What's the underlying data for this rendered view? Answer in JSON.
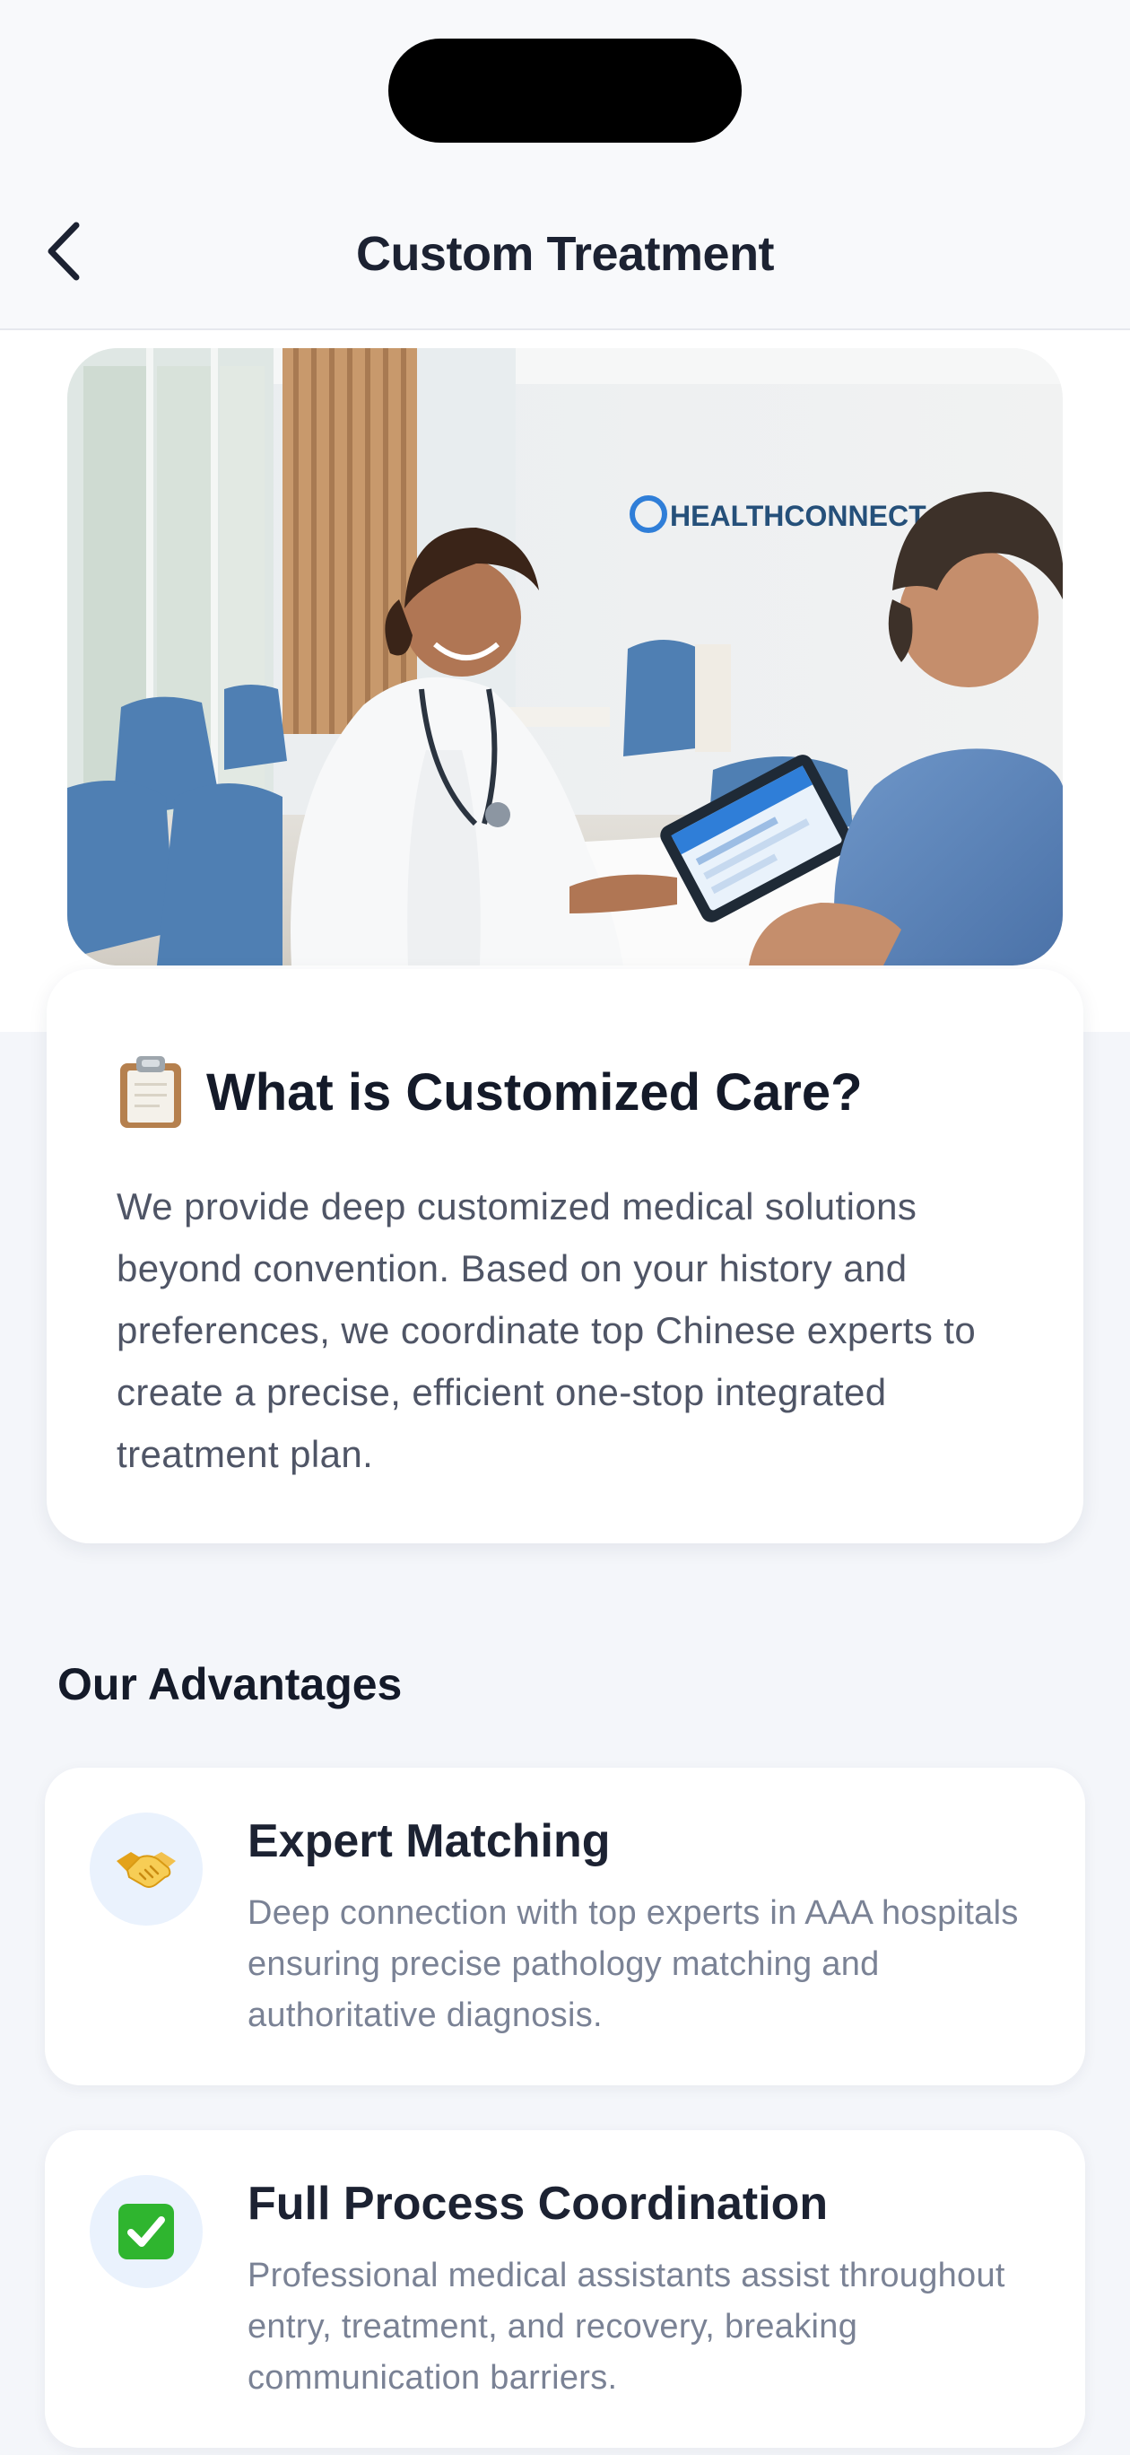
{
  "header": {
    "title": "Custom Treatment"
  },
  "hero": {
    "sign_text": "HEALTHCONNECT"
  },
  "intro": {
    "icon": "clipboard-icon",
    "title": "What is Customized Care?",
    "text": "We provide deep customized medical solutions beyond convention. Based on your history and preferences, we coordinate top Chinese experts to create a precise, efficient one-stop integrated treatment plan."
  },
  "advantages": {
    "title": "Our Advantages",
    "items": [
      {
        "icon": "handshake-icon",
        "title": "Expert Matching",
        "desc": "Deep connection with top experts in AAA hospitals ensuring precise pathology matching and authoritative diagnosis."
      },
      {
        "icon": "check-mark-icon",
        "title": "Full Process Coordination",
        "desc": "Professional medical assistants assist throughout entry, treatment, and recovery, breaking communication barriers."
      }
    ]
  },
  "colors": {
    "accent": "#2f7ed8",
    "title_text": "#141a29",
    "body_text": "#4f5566",
    "muted_text": "#7a8295",
    "icon_circle_bg": "#eaf2fd"
  }
}
